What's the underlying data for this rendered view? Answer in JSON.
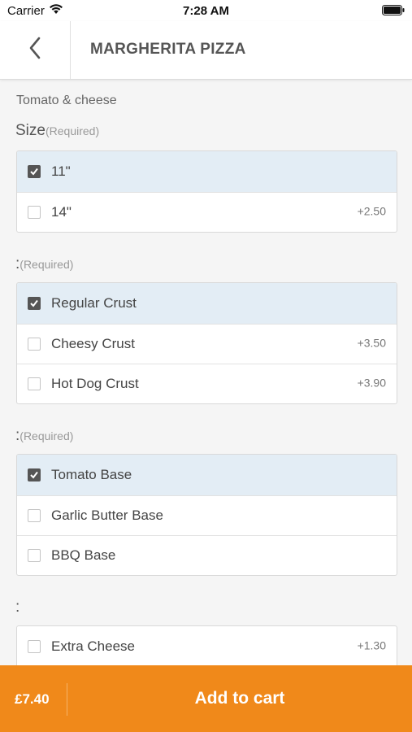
{
  "status": {
    "carrier": "Carrier",
    "time": "7:28 AM"
  },
  "nav": {
    "title": "MARGHERITA PIZZA"
  },
  "product": {
    "description": "Tomato & cheese"
  },
  "groups": [
    {
      "title": "Size",
      "required": "(Required)",
      "options": [
        {
          "label": "11\"",
          "price": "",
          "selected": true
        },
        {
          "label": "14\"",
          "price": "+2.50",
          "selected": false
        }
      ]
    },
    {
      "title": ":",
      "required": "(Required)",
      "options": [
        {
          "label": "Regular Crust",
          "price": "",
          "selected": true
        },
        {
          "label": "Cheesy Crust",
          "price": "+3.50",
          "selected": false
        },
        {
          "label": "Hot Dog Crust",
          "price": "+3.90",
          "selected": false
        }
      ]
    },
    {
      "title": ":",
      "required": "(Required)",
      "options": [
        {
          "label": "Tomato Base",
          "price": "",
          "selected": true
        },
        {
          "label": "Garlic Butter Base",
          "price": "",
          "selected": false
        },
        {
          "label": "BBQ Base",
          "price": "",
          "selected": false
        }
      ]
    },
    {
      "title": ":",
      "required": "",
      "options": [
        {
          "label": "Extra Cheese",
          "price": "+1.30",
          "selected": false
        }
      ]
    }
  ],
  "footer": {
    "total": "£7.40",
    "add_label": "Add to cart"
  },
  "colors": {
    "accent": "#f0891a",
    "selected_row": "#e3edf5"
  }
}
